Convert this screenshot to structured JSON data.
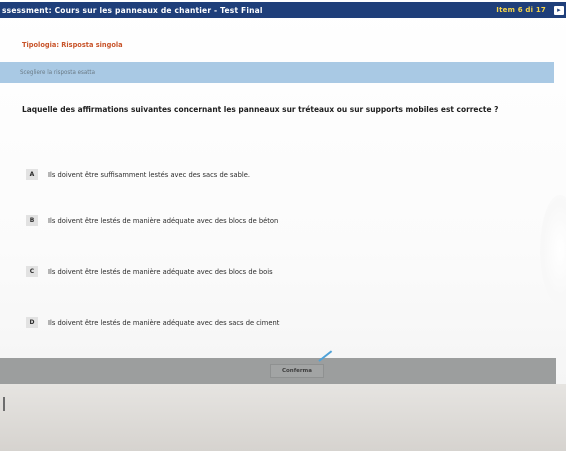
{
  "header": {
    "title": "ssessment: Cours sur les panneaux de chantier - Test Final",
    "item_counter": "Item 6 di 17",
    "next_icon": "arrow-right-icon"
  },
  "tipologia": "Tipologia: Risposta singola",
  "instruction": "Scegliere la risposta esatta",
  "question": "Laquelle des affirmations suivantes concernant les panneaux sur tréteaux ou sur supports mobiles est correcte ?",
  "options": [
    {
      "letter": "A",
      "text": "Ils doivent être suffisamment lestés avec des sacs de sable."
    },
    {
      "letter": "B",
      "text": "Ils doivent être lestés de manière adéquate avec des blocs de béton"
    },
    {
      "letter": "C",
      "text": "Ils doivent être lestés de manière adéquate avec des blocs de bois"
    },
    {
      "letter": "D",
      "text": "Ils doivent être lestés de manière adéquate avec des sacs de ciment"
    }
  ],
  "footer": {
    "confirm_label": "Conferma"
  }
}
